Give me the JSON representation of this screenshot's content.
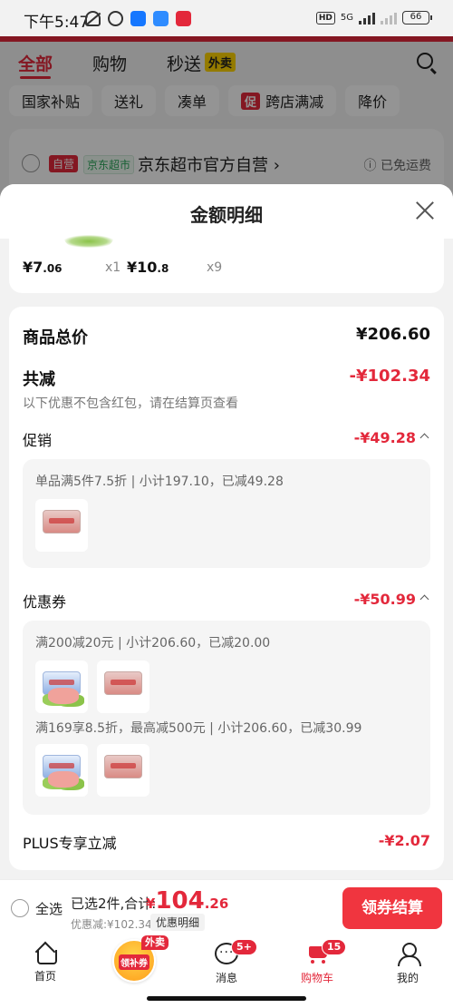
{
  "status_bar": {
    "time": "下午5:47",
    "network": "5G",
    "battery": "66"
  },
  "background": {
    "tabs": [
      {
        "label": "全部",
        "active": true
      },
      {
        "label": "购物",
        "active": false
      },
      {
        "label": "秒送",
        "active": false,
        "tag": "外卖"
      }
    ],
    "chips": [
      {
        "label": "国家补贴"
      },
      {
        "label": "送礼"
      },
      {
        "label": "凑单"
      },
      {
        "label": "跨店满减",
        "tag": "促"
      },
      {
        "label": "降价"
      }
    ],
    "shop": {
      "badge": "自营",
      "badge2": "京东超市",
      "name": "京东超市官方自营",
      "shipping": "已免运费"
    }
  },
  "sheet": {
    "title": "金额明细",
    "items": [
      {
        "price_int": "¥7",
        "price_dec": ".06",
        "qty": "x1"
      },
      {
        "price_int": "¥10",
        "price_dec": ".8",
        "qty": "x9"
      }
    ],
    "total_label": "商品总价",
    "total_value": "¥206.60",
    "discount_label": "共减",
    "discount_value": "-¥102.34",
    "discount_note": "以下优惠不包含红包，请在结算页查看",
    "promo_label": "促销",
    "promo_value": "-¥49.28",
    "promo_rule": "单品满5件7.5折 | 小计197.10，已减49.28",
    "coupon_label": "优惠券",
    "coupon_value": "-¥50.99",
    "coupon_rule_1": "满200减20元 | 小计206.60，已减20.00",
    "coupon_rule_2": "满169享8.5折，最高减500元 | 小计206.60，已减30.99",
    "plus_label": "PLUS专享立减",
    "plus_value": "-¥2.07"
  },
  "checkout": {
    "select_all": "全选",
    "selected_text": "已选2件,合计:",
    "price_symbol": "¥",
    "price_int": "104",
    "price_dec": ".26",
    "discount_text": "优惠减:¥102.34",
    "detail_tag": "优惠明细",
    "button": "领券结算"
  },
  "bottom_nav": {
    "home": "首页",
    "promo_inner": "领补券",
    "promo_tag": "外卖",
    "messages": "消息",
    "messages_badge": "5+",
    "cart": "购物车",
    "cart_badge": "15",
    "mine": "我的"
  },
  "colors": {
    "accent": "#e3283b",
    "button": "#f0353f"
  }
}
